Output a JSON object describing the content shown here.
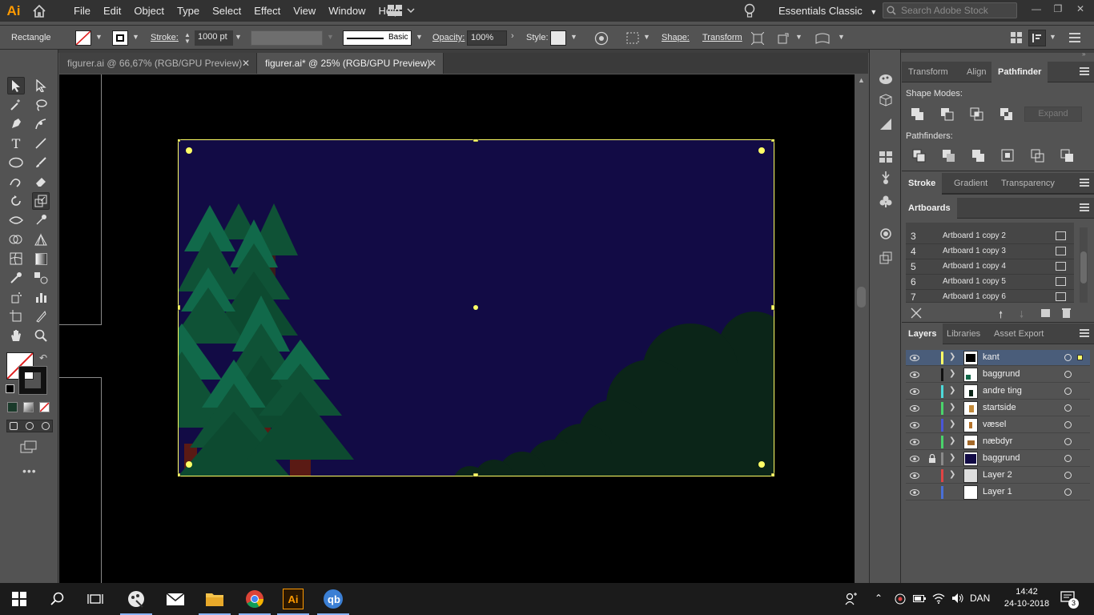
{
  "app": {
    "logo": "Ai"
  },
  "menu": [
    "File",
    "Edit",
    "Object",
    "Type",
    "Select",
    "Effect",
    "View",
    "Window",
    "Help"
  ],
  "workspace": "Essentials Classic",
  "search": {
    "placeholder": "Search Adobe Stock"
  },
  "control_bar": {
    "tool_name": "Rectangle",
    "stroke_label": "Stroke:",
    "stroke_value": "1000 pt",
    "brush_label": "Basic",
    "opacity_label": "Opacity:",
    "opacity_value": "100%",
    "style_label": "Style:",
    "shape_label": "Shape:",
    "transform_label": "Transform"
  },
  "tabs": [
    {
      "label": "figurer.ai @ 66,67% (RGB/GPU Preview)",
      "active": false
    },
    {
      "label": "figurer.ai* @ 25% (RGB/GPU Preview)",
      "active": true
    }
  ],
  "pathfinder_panel": {
    "tabs": [
      "Transform",
      "Align",
      "Pathfinder"
    ],
    "shape_modes_label": "Shape Modes:",
    "pathfinders_label": "Pathfinders:",
    "expand_label": "Expand"
  },
  "stroke_panel": {
    "tabs": [
      "Stroke",
      "Gradient",
      "Transparency"
    ]
  },
  "artboards_panel": {
    "title": "Artboards",
    "items": [
      {
        "num": "3",
        "name": "Artboard 1 copy 2"
      },
      {
        "num": "4",
        "name": "Artboard 1 copy 3"
      },
      {
        "num": "5",
        "name": "Artboard 1 copy 4"
      },
      {
        "num": "6",
        "name": "Artboard 1 copy 5"
      },
      {
        "num": "7",
        "name": "Artboard 1 copy 6"
      }
    ]
  },
  "layers_panel": {
    "tabs": [
      "Layers",
      "Libraries",
      "Asset Export"
    ],
    "layers": [
      {
        "name": "kant",
        "color": "#ffff66",
        "selected": true,
        "locked": false
      },
      {
        "name": "baggrund",
        "color": "#111111",
        "selected": false,
        "locked": false
      },
      {
        "name": "andre ting",
        "color": "#4dd9d9",
        "selected": false,
        "locked": false
      },
      {
        "name": "startside",
        "color": "#4ad36b",
        "selected": false,
        "locked": false
      },
      {
        "name": "væsel",
        "color": "#4a56d6",
        "selected": false,
        "locked": false
      },
      {
        "name": "næbdyr",
        "color": "#4ad36b",
        "selected": false,
        "locked": false
      },
      {
        "name": "baggrund",
        "color": "#8a8a8a",
        "selected": false,
        "locked": true
      },
      {
        "name": "Layer 2",
        "color": "#e04444",
        "selected": false,
        "locked": false
      },
      {
        "name": "Layer 1",
        "color": "#4a6fd6",
        "selected": false,
        "locked": false
      }
    ]
  },
  "taskbar": {
    "language": "DAN",
    "time": "14:42",
    "date": "24-10-2018",
    "notifications": "3"
  },
  "colors": {
    "accent": "#ff9a00",
    "selection": "#ffff66",
    "sky": "#120b45",
    "tree": "#11694a",
    "bush": "#0b2518"
  }
}
